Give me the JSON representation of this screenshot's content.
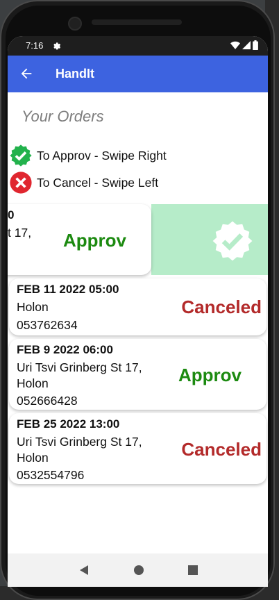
{
  "status": {
    "time": "7:16"
  },
  "appbar": {
    "title": "HandIt"
  },
  "page": {
    "title": "Your Orders"
  },
  "legend": {
    "approve": "To Approv - Swipe Right",
    "cancel": "To Cancel - Swipe Left"
  },
  "orders": [
    {
      "date_partial": "0",
      "address_partial": "t 17,",
      "status": "Approv"
    },
    {
      "date": "FEB 11 2022 05:00",
      "city": "Holon",
      "phone": "053762634",
      "status": "Canceled"
    },
    {
      "date": "FEB 9 2022 06:00",
      "address": "Uri Tsvi Grinberg St 17,",
      "city": "Holon",
      "phone": "052666428",
      "status": "Approv"
    },
    {
      "date": "FEB 25 2022 13:00",
      "address": "Uri Tsvi Grinberg St 17,",
      "city": "Holon",
      "phone": "0532554796",
      "status": "Canceled"
    }
  ],
  "colors": {
    "appbar": "#3d63e0",
    "approved": "#1c8a10",
    "canceled": "#b32a2a",
    "swipe_bg": "#b6ecc9",
    "approve_icon": "#22b24c",
    "cancel_icon": "#e0262f"
  },
  "icons": {
    "back": "arrow-left-icon",
    "settings": "gear-icon",
    "approve": "verified-check-icon",
    "cancel": "cancel-x-icon"
  }
}
